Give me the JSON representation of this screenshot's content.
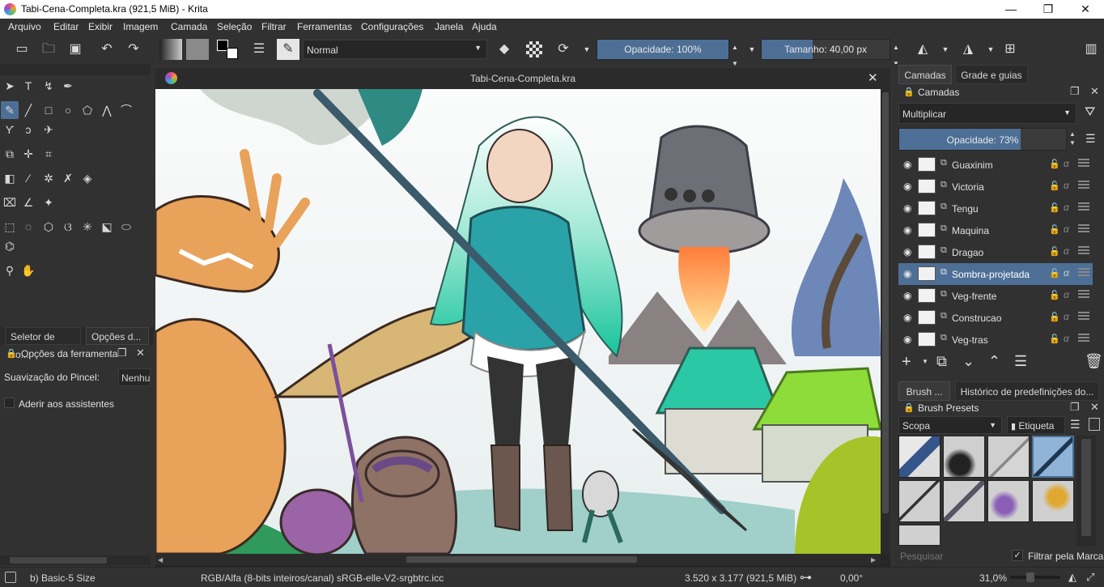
{
  "window": {
    "title": "Tabi-Cena-Completa.kra (921,5 MiB)  - Krita",
    "minimize": "—",
    "maximize": "❐",
    "close": "✕"
  },
  "menu": [
    "Arquivo",
    "Editar",
    "Exibir",
    "Imagem",
    "Camada",
    "Seleção",
    "Filtrar",
    "Ferramentas",
    "Configurações",
    "Janela",
    "Ajuda"
  ],
  "toolbar": {
    "blend_mode": "Normal",
    "opacity": "Opacidade: 100%",
    "opacity_value": 1.0,
    "size": "Tamanho: 40,00 px",
    "accent": "#4d6f96"
  },
  "left_dock": {
    "tab_color": "Seletor de co...",
    "tab_options": "Opções d...",
    "tool_options_title": "Opções da ferramenta",
    "smoothing_label": "Suavização do Pincel:",
    "smoothing_value": "Nenhu",
    "assistants_label": "Aderir aos assistentes"
  },
  "canvas": {
    "doc_title": "Tabi-Cena-Completa.kra"
  },
  "layers_dock": {
    "tab_layers": "Camadas",
    "tab_grid": "Grade e guias",
    "panel_title": "Camadas",
    "blend_mode": "Multiplicar",
    "opacity": "Opacidade:  73%",
    "opacity_value": 0.73,
    "layers": [
      {
        "name": "Guaxinim",
        "active": false
      },
      {
        "name": "Victoria",
        "active": false
      },
      {
        "name": "Tengu",
        "active": false
      },
      {
        "name": "Maquina",
        "active": false
      },
      {
        "name": "Dragao",
        "active": false
      },
      {
        "name": "Sombra-projetada",
        "active": true
      },
      {
        "name": "Veg-frente",
        "active": false
      },
      {
        "name": "Construcao",
        "active": false
      },
      {
        "name": "Veg-tras",
        "active": false
      }
    ]
  },
  "brush_dock": {
    "tab_brush": "Brush ...",
    "tab_history": "Histórico de predefinições do...",
    "panel_title": "Brush Presets",
    "scope": "Scopa",
    "tag": "Etiqueta",
    "search_placeholder": "Pesquisar",
    "filter_label": "Filtrar pela Marca"
  },
  "status": {
    "brush": "b) Basic-5 Size",
    "color_space": "RGB/Alfa (8-bits inteiros/canal)  sRGB-elle-V2-srgbtrc.icc",
    "dimensions": "3.520 x 3.177 (921,5 MiB)",
    "rotation": "0,00°",
    "zoom": "31,0%"
  }
}
